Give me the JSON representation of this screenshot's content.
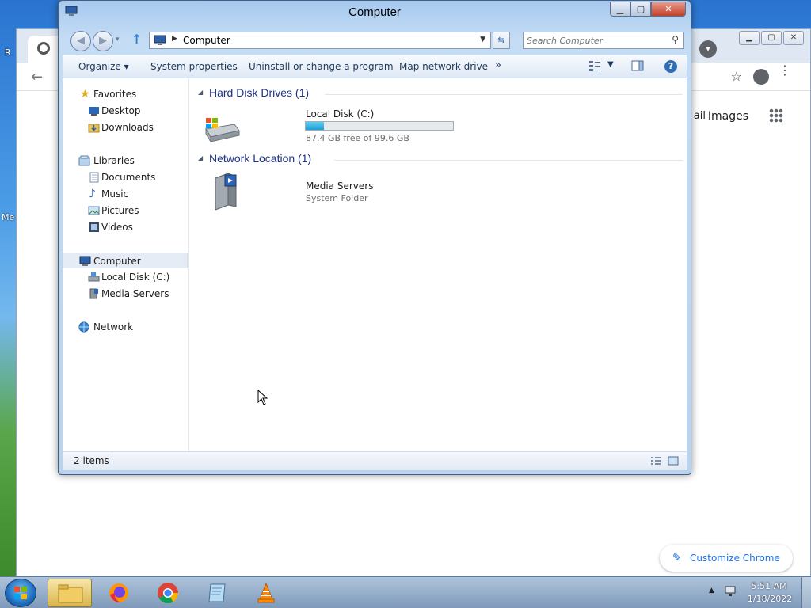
{
  "explorer": {
    "title": "Computer",
    "address": "Computer",
    "search_placeholder": "Search Computer",
    "commands": [
      "Organize",
      "System properties",
      "Uninstall or change a program",
      "Map network drive"
    ],
    "overflow_glyph": "»",
    "nav": {
      "favorites": "Favorites",
      "desktop": "Desktop",
      "downloads": "Downloads",
      "libraries": "Libraries",
      "documents": "Documents",
      "music": "Music",
      "pictures": "Pictures",
      "videos": "Videos",
      "computer": "Computer",
      "local_disk": "Local Disk (C:)",
      "media_servers": "Media Servers",
      "network": "Network"
    },
    "groups": {
      "hard_disks": "Hard Disk Drives (1)",
      "network_location": "Network Location (1)"
    },
    "local_disk": {
      "name": "Local Disk (C:)",
      "free_text": "87.4 GB free of 99.6 GB",
      "used_fraction": 0.1225
    },
    "media_servers": {
      "name": "Media Servers",
      "type": "System Folder"
    },
    "status": "2 items",
    "window_buttons": {
      "minimize": "▁",
      "maximize": "▢",
      "close": "✕"
    }
  },
  "chrome": {
    "mail_partial": "ail",
    "images": "Images",
    "customize": "Customize Chrome"
  },
  "taskbar": {
    "time": "5:51 AM",
    "date": "1/18/2022"
  },
  "colors": {
    "group_header": "#1e3287",
    "disk_fill": "#1e9ed6",
    "chrome_accent": "#1a73e8"
  }
}
